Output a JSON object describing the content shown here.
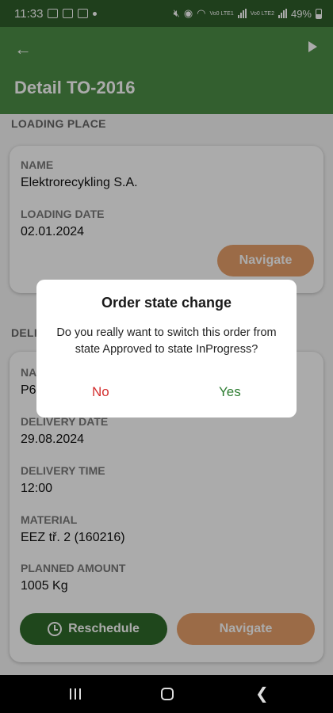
{
  "status_bar": {
    "time": "11:33",
    "battery": "49%",
    "network_label_1": "Vo0 LTE1",
    "network_label_2": "Vo0 LTE2"
  },
  "app_bar": {
    "title": "Detail TO-2016",
    "back_icon": "arrow-left-icon",
    "action_icon": "play-icon"
  },
  "loading": {
    "section_label": "LOADING PLACE",
    "name_label": "NAME",
    "name_value": "Elektrorecykling S.A.",
    "date_label": "LOADING DATE",
    "date_value": "02.01.2024",
    "navigate_label": "Navigate"
  },
  "delivery": {
    "section_label": "DELI",
    "name_label": "NA",
    "name_value": "P6",
    "date_label": "DELIVERY DATE",
    "date_value": "29.08.2024",
    "time_label": "DELIVERY TIME",
    "time_value": "12:00",
    "material_label": "MATERIAL",
    "material_value": "EEZ tř. 2 (160216)",
    "amount_label": "PLANNED AMOUNT",
    "amount_value": "1005 Kg",
    "reschedule_label": "Reschedule",
    "navigate_label": "Navigate"
  },
  "dialog": {
    "title": "Order state change",
    "message": "Do you really want to switch this order from state Approved to state InProgress?",
    "no_label": "No",
    "yes_label": "Yes"
  },
  "colors": {
    "primary": "#4d8e47",
    "primary_dark": "#2f5e2b",
    "accent_orange": "#e8a06a",
    "button_green": "#2f6b2a",
    "no_red": "#d32f2f",
    "yes_green": "#2e7d32"
  }
}
